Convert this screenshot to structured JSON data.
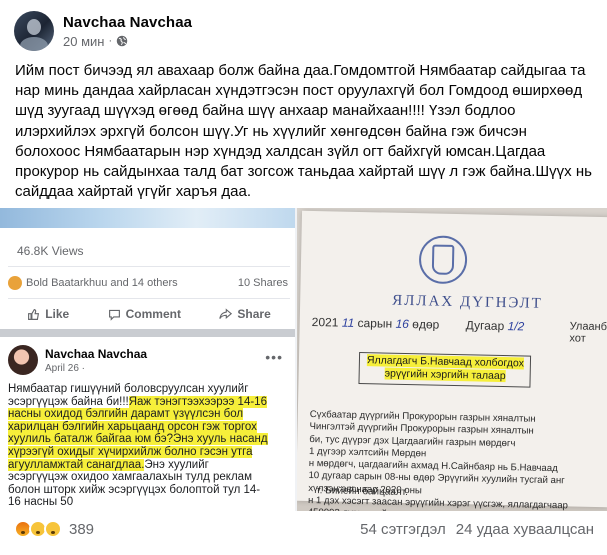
{
  "post": {
    "author": "Navchaa Navchaa",
    "time": "20 мин",
    "separator": "·",
    "audience_icon": "globe-icon",
    "text": "Ийм пост бичээд ял авахаар болж байна даа.Гомдомтгой Нямбаатар сайдыгаа та нар минь дандаа хайрласан хүндэтгэсэн пост оруулахгүй бол Гомдоод өширхөөд шүд зуугаад шүүхэд өгөөд байна шүү анхаар манайхаан!!!! Үзэл бодлоо илэрхийлэх эрхгүй болсон шүү.Уг нь хүүлийг хөнгөдсөн байна гэж бичсэн болохоос Нямбаатарын нэр хүндэд халдсан зүйл огт байхгүй юмсан.Цагдаа прокурор нь сайдынхаа талд бат зогсож таньдаа хайртай шүү л гэж байна.Шүүх нь сайддаа хайртай үгүйг харъя даа."
  },
  "screenshot_left": {
    "views": "46.8K Views",
    "reacted_by": "Bold Baatarkhuu and 14 others",
    "shares": "10 Shares",
    "like_label": "Like",
    "comment_label": "Comment",
    "share_label": "Share",
    "inner_author": "Navchaa Navchaa",
    "inner_date": "April 26 ·",
    "inner_text_plain": "Нямбаатар гишүүний боловсруулсан хуулийг эсэргүүцэж байна би!!!",
    "inner_text_highlight": "Яаж тэнэгтээхээрээ 14-16 насны охидод бэлгийн дарамт үзүүлсэн бол харилцан бэлгийн харьцаанд орсон гэж торгох хуулиль баталж байгаа юм бэ?Энэ хууль насанд хүрээгүй охидыг хүчирхийлж болно гэсэн утга агуулламжтай санагдлаа.",
    "inner_text_rest": "Энэ хуулийг эсэргүүцэж охидоо хамгаалахын тулд реклам болон шторк хийж эсэргүүцэх болоптой тул 14-16 насны 50"
  },
  "screenshot_right": {
    "doc_title": "ЯЛЛАХ ДҮГНЭЛТ",
    "date_year": "2021",
    "date_month": "11",
    "date_month_label": "сарын",
    "date_day": "16",
    "date_day_label": "өдөр",
    "doc_number_label": "Дугаар",
    "doc_number": "1/2",
    "place": "Улаанбаатар хот",
    "subject": "Яллагдагч Б.Навчаад холбогдох эрүүгийн хэргийн талаар",
    "body_lines": [
      "Сүхбаатар дүүргийн Прокурорын газрын хяналтын",
      "Чингэлтэй дүүргийн Прокурорын газрын хяналтын",
      "би, тус дүүрэг дэх Цагдаагийн газрын мөрдөгч",
      "1 дүгээр хэлтсийн Мөрдөн",
      "н мөрдөгч, цагдаагийн ахмад Н.Сайнбаяр нь Б.Навчаад",
      "10 дугаар сарын 08-ны өдөр Эрүүгийн хуулийн тусгай анг",
      "хүлээн авснаар 2020 оны",
      "н 1 дэх хэсэгт заасан эрүүгийн хэрэг үүсгэж, яллагдагчаар",
      "450993 дугаартай хэрэг мөрдөн байцаалт явуулж дуусгасан",
      "0 сарын 09-ний өдөр шүүхэд шилжүүлэх санал гаргаж, 2020 оны",
      "эрүүгийн хэргийг прокурор хүлээн авч хянаад ТЭМДЭГЛЭХ нь"
    ],
    "signer": "т. Бийейн байцаалт."
  },
  "footer": {
    "reaction_icons": [
      "angry-reaction-icon",
      "sad-reaction-icon",
      "wow-reaction-icon"
    ],
    "reaction_count": "389",
    "comments": "54 сэтгэгдэл",
    "shares": "24 удаа хуваалцсан"
  }
}
